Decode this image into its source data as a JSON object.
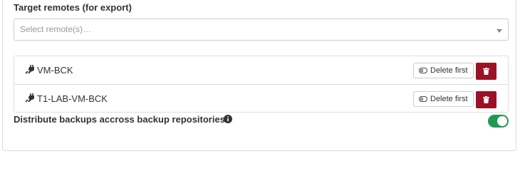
{
  "target_remotes": {
    "label": "Target remotes (for export)",
    "placeholder": "Select remote(s)…"
  },
  "remotes": [
    {
      "name": "VM-BCK",
      "delete_first_label": "Delete first",
      "icon": "plug-icon"
    },
    {
      "name": "T1-LAB-VM-BCK",
      "delete_first_label": "Delete first",
      "icon": "plug-icon"
    }
  ],
  "distribute": {
    "label": "Distribute backups accross backup repositories",
    "enabled": true,
    "icon": "info-circle-icon"
  },
  "colors": {
    "danger": "#9b1226",
    "toggle_on": "#1e9a55"
  }
}
